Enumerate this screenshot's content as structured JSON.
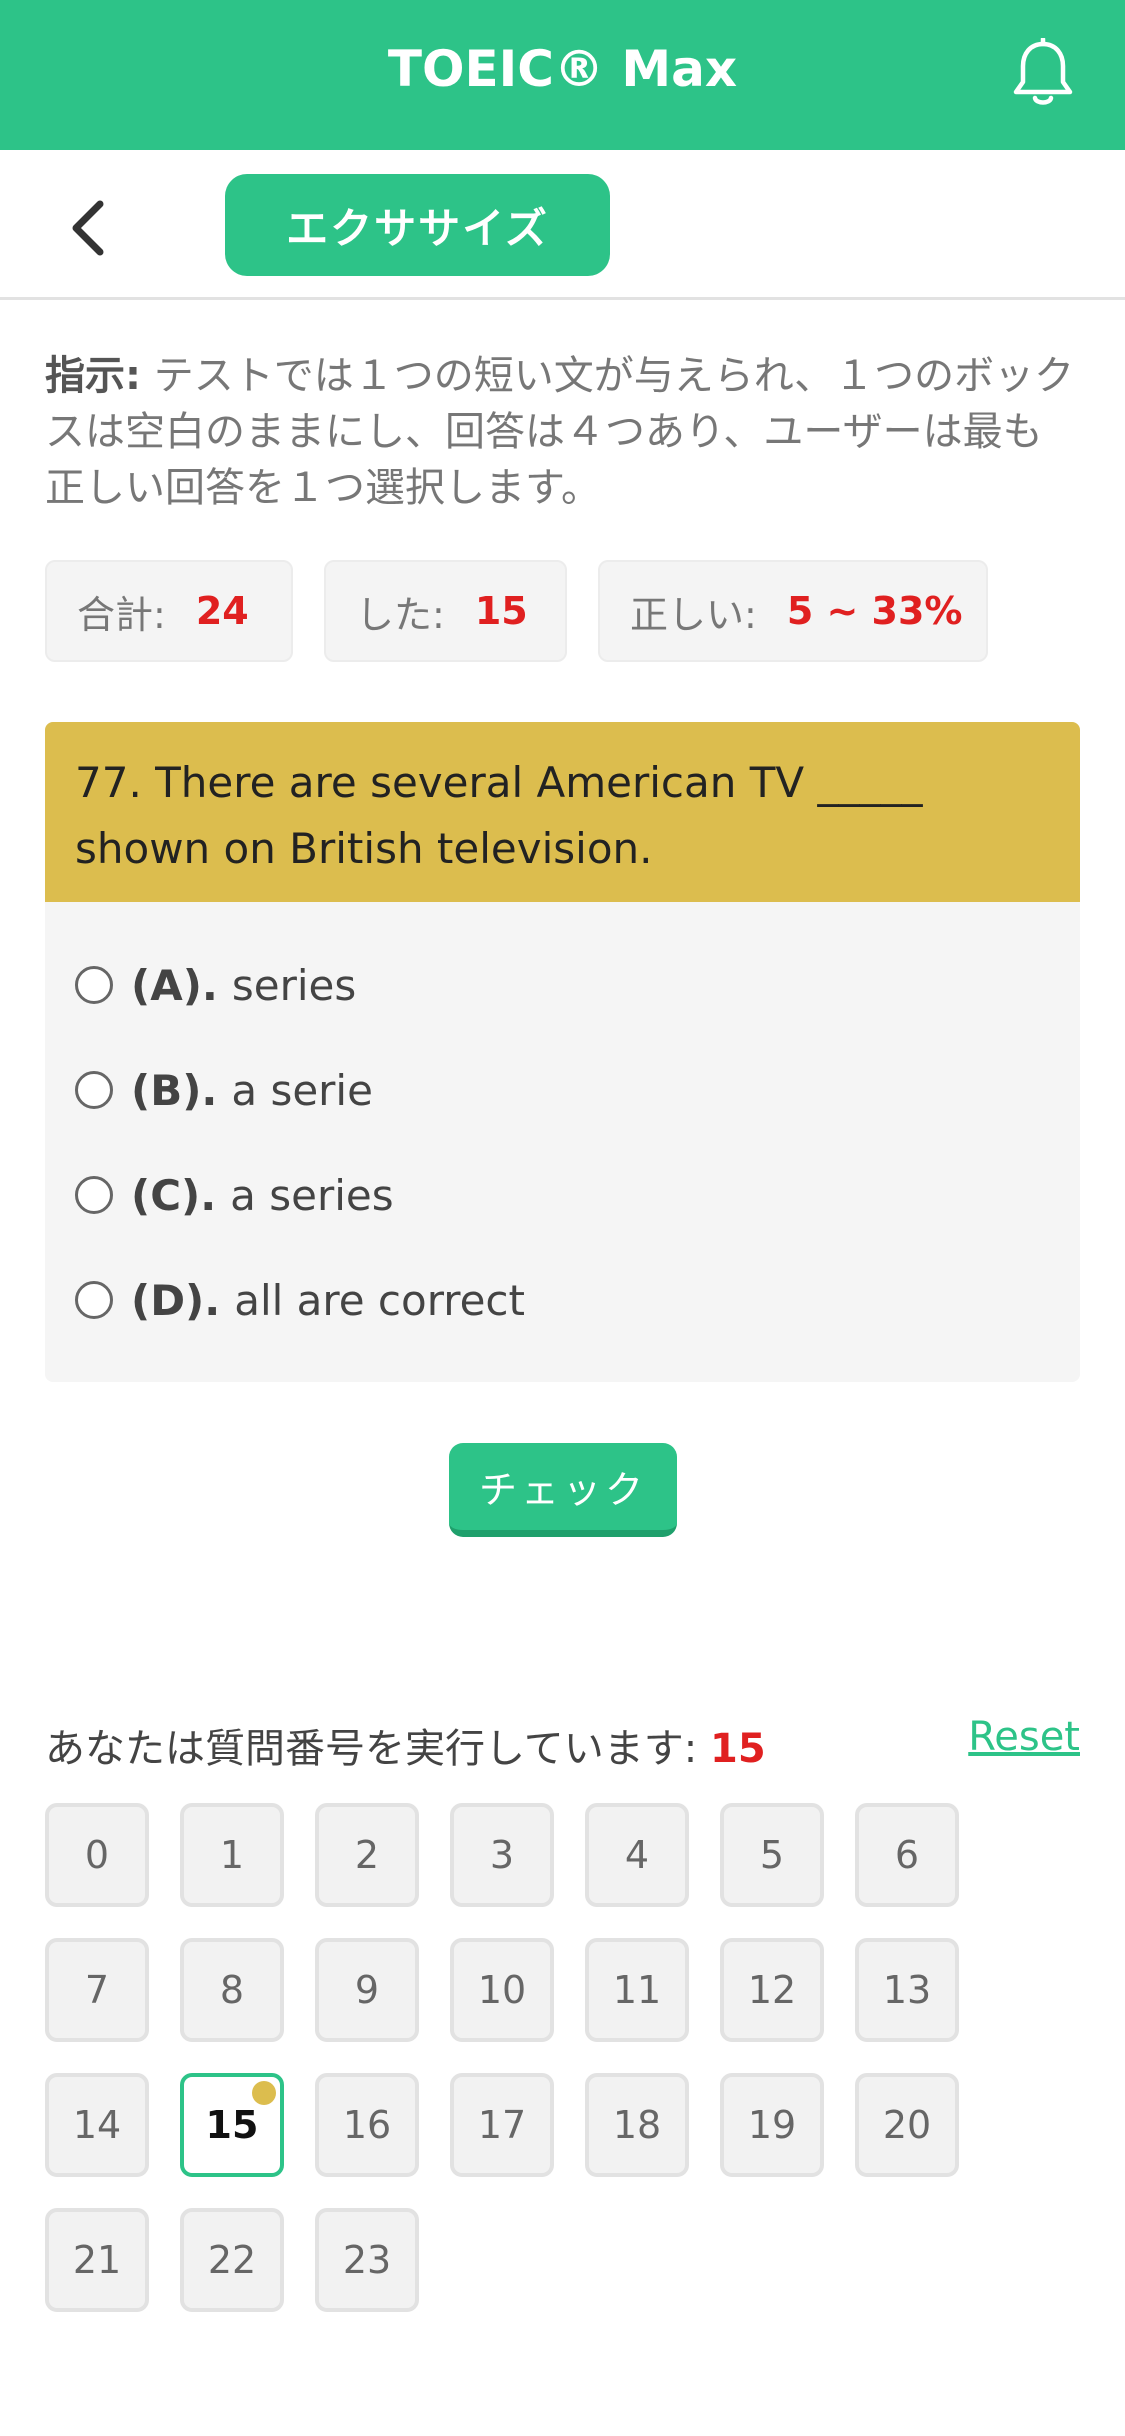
{
  "header": {
    "title": "TOEIC® Max",
    "bell_icon": "bell-icon"
  },
  "subnav": {
    "back_icon": "chevron-left-icon",
    "tab_label": "エクササイズ"
  },
  "instructions": {
    "label": "指示:",
    "text": " テストでは１つの短い文が与えられ、１つのボックスは空白のままにし、回答は４つあり、ユーザーは最も正しい回答を１つ選択します。"
  },
  "stats": [
    {
      "label": "合計:",
      "value": "24"
    },
    {
      "label": "した:",
      "value": "15"
    },
    {
      "label": "正しい:",
      "value": "5 ~ 33%"
    }
  ],
  "question": {
    "text": "77. There are several American TV _____ shown on British television.",
    "options": [
      {
        "letter": "(A).",
        "text": "series"
      },
      {
        "letter": "(B).",
        "text": "a serie"
      },
      {
        "letter": "(C).",
        "text": "a series"
      },
      {
        "letter": "(D).",
        "text": "all are correct"
      }
    ]
  },
  "check_label": "チェック",
  "progress": {
    "label": "あなたは質問番号を実行しています: ",
    "current": "15",
    "reset_label": "Reset"
  },
  "question_numbers": [
    "0",
    "1",
    "2",
    "3",
    "4",
    "5",
    "6",
    "7",
    "8",
    "9",
    "10",
    "11",
    "12",
    "13",
    "14",
    "15",
    "16",
    "17",
    "18",
    "19",
    "20",
    "21",
    "22",
    "23"
  ],
  "colors": {
    "accent": "#2dc388",
    "question_bg": "#dcbd4e",
    "highlight_value": "#e02020"
  }
}
